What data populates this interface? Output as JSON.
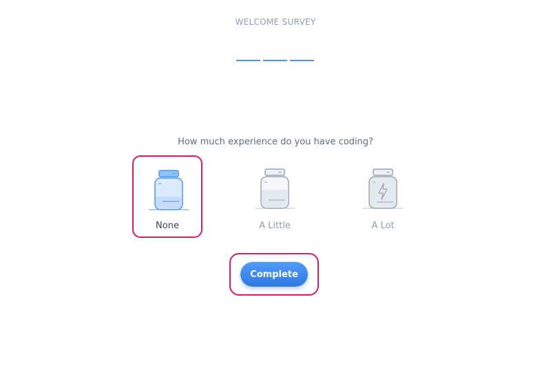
{
  "header": {
    "title": "WELCOME SURVEY",
    "progress_steps": 3
  },
  "question": {
    "text": "How much experience do you have coding?"
  },
  "options": [
    {
      "label": "None",
      "selected": true,
      "icon": "empty-jar-icon"
    },
    {
      "label": "A Little",
      "selected": false,
      "icon": "half-full-jar-icon"
    },
    {
      "label": "A Lot",
      "selected": false,
      "icon": "charged-jar-icon"
    }
  ],
  "actions": {
    "complete_label": "Complete"
  },
  "colors": {
    "accent": "#4a95f2",
    "highlight": "#e8175d",
    "muted_text": "#8f9cb0"
  }
}
